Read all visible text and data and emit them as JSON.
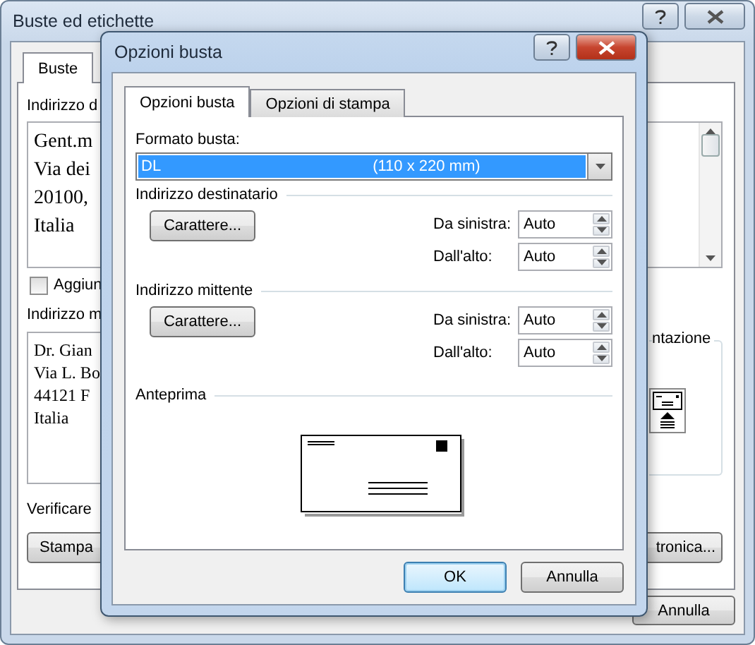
{
  "window": {
    "title": "Buste ed etichette"
  },
  "outer": {
    "tabs": [
      {
        "label": "Buste",
        "selected": true
      }
    ],
    "delivery_label": "Indirizzo d",
    "delivery_lines": [
      "Gent.m",
      "Via dei",
      "20100,",
      "Italia"
    ],
    "add_checkbox": {
      "label": "Aggiun",
      "checked": false
    },
    "return_label": "Indirizzo m",
    "return_lines": [
      "Dr. Gian",
      "Via L. Bo",
      "44121 F",
      "Italia"
    ],
    "feed_label": "ntazione",
    "verify_text": "Verificare",
    "left_button": "Stampa",
    "right_button": "tronica...",
    "cancel_button": "Annulla"
  },
  "dialog": {
    "title": "Opzioni busta",
    "tabs": [
      {
        "label": "Opzioni busta",
        "selected": true
      },
      {
        "label": "Opzioni di stampa",
        "selected": false
      }
    ],
    "size_label": "Formato busta:",
    "size_value": {
      "name": "DL",
      "dims": "(110 x 220 mm)"
    },
    "sections": [
      {
        "title": "Indirizzo destinatario",
        "font_button": "Carattere...",
        "fields": [
          {
            "label": "Da sinistra:",
            "value": "Auto"
          },
          {
            "label": "Dall'alto:",
            "value": "Auto"
          }
        ]
      },
      {
        "title": "Indirizzo mittente",
        "font_button": "Carattere...",
        "fields": [
          {
            "label": "Da sinistra:",
            "value": "Auto"
          },
          {
            "label": "Dall'alto:",
            "value": "Auto"
          }
        ]
      }
    ],
    "preview_label": "Anteprima",
    "buttons": [
      {
        "label": "OK",
        "default": true
      },
      {
        "label": "Annulla",
        "default": false
      }
    ]
  }
}
